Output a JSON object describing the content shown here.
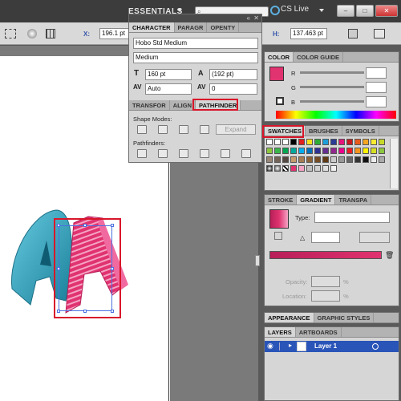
{
  "app": {
    "workspace": "ESSENTIALS",
    "cs_live": "CS Live",
    "window_buttons": [
      "–",
      "□",
      "✕"
    ]
  },
  "control_bar": {
    "x_label": "X:",
    "x_value": "196.1 pt",
    "h_label": "H:",
    "h_value": "137.463 pt"
  },
  "character_panel": {
    "tabs": [
      "CHARACTER",
      "PARAGR",
      "OPENTY"
    ],
    "font_family": "Hobo Std Medium",
    "font_style": "Medium",
    "font_size": "160 pt",
    "leading": "(192 pt)",
    "kerning": "Auto",
    "tracking": "0"
  },
  "pathfinder_panel": {
    "tabs": [
      "TRANSFOR",
      "ALIGN",
      "PATHFINDER"
    ],
    "shape_modes_label": "Shape Modes:",
    "expand_label": "Expand",
    "pathfinders_label": "Pathfinders:"
  },
  "color_panel": {
    "tabs": [
      "COLOR",
      "COLOR GUIDE"
    ],
    "channels": [
      "R",
      "G",
      "B"
    ]
  },
  "swatches_panel": {
    "tabs": [
      "SWATCHES",
      "BRUSHES",
      "SYMBOLS"
    ],
    "highlighted_tab": "SWATCHES"
  },
  "gradient_panel": {
    "tabs": [
      "STROKE",
      "GRADIENT",
      "TRANSPA"
    ],
    "type_label": "Type:",
    "opacity_label": "Opacity:",
    "location_label": "Location:",
    "percent": "%"
  },
  "appearance_panel": {
    "tabs": [
      "APPEARANCE",
      "GRAPHIC STYLES"
    ]
  },
  "layers_panel": {
    "tabs": [
      "LAYERS",
      "ARTBOARDS"
    ],
    "layer_name": "Layer 1"
  },
  "colors": {
    "accent_pink": "#e0336f",
    "teal": "#2a9fb8",
    "selection_red": "#d9162a",
    "layer_blue": "#2a55b8"
  },
  "icons": [
    "search-icon",
    "cs-live-icon",
    "eye-icon",
    "lock-icon",
    "gradient-swatch-icon",
    "trash-icon"
  ]
}
